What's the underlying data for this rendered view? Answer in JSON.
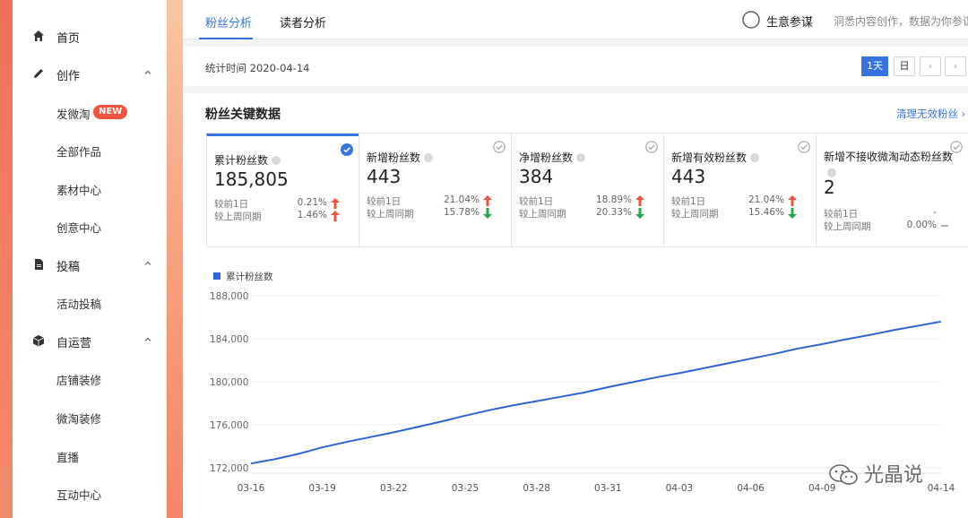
{
  "sidebar": {
    "items": [
      {
        "label": "首页",
        "type": "parent",
        "icon": "home-icon"
      },
      {
        "label": "创作",
        "type": "parent",
        "icon": "pencil-icon",
        "expanded": true
      },
      {
        "label": "发微淘",
        "type": "child",
        "badge": "NEW"
      },
      {
        "label": "全部作品",
        "type": "child"
      },
      {
        "label": "素材中心",
        "type": "child"
      },
      {
        "label": "创意中心",
        "type": "child"
      },
      {
        "label": "投稿",
        "type": "parent",
        "icon": "document-icon",
        "expanded": true
      },
      {
        "label": "活动投稿",
        "type": "child"
      },
      {
        "label": "自运营",
        "type": "parent",
        "icon": "cube-icon",
        "expanded": true
      },
      {
        "label": "店铺装修",
        "type": "child"
      },
      {
        "label": "微淘装修",
        "type": "child"
      },
      {
        "label": "直播",
        "type": "child"
      },
      {
        "label": "互动中心",
        "type": "child"
      }
    ]
  },
  "header": {
    "tabs": [
      {
        "label": "粉丝分析",
        "active": true
      },
      {
        "label": "读者分析",
        "active": false
      }
    ],
    "brand_name": "生意参谋",
    "brand_slogan": "洞悉内容创作，数据为你参谋"
  },
  "datebar": {
    "label": "统计时间 2020-04-14",
    "btn_1d": "1天",
    "btn_day": "日",
    "btn_prev": "‹",
    "btn_next": "›"
  },
  "panel": {
    "title": "粉丝关键数据",
    "clean_link": "清理无效粉丝 ›"
  },
  "cards": [
    {
      "title": "累计粉丝数",
      "value": "185,805",
      "selected": true,
      "cmp1_label": "较前1日",
      "cmp1_val": "0.21%",
      "cmp1_dir": "up",
      "cmp2_label": "较上周同期",
      "cmp2_val": "1.46%",
      "cmp2_dir": "up"
    },
    {
      "title": "新增粉丝数",
      "value": "443",
      "selected": false,
      "cmp1_label": "较前1日",
      "cmp1_val": "21.04%",
      "cmp1_dir": "up",
      "cmp2_label": "较上周同期",
      "cmp2_val": "15.78%",
      "cmp2_dir": "down"
    },
    {
      "title": "净增粉丝数",
      "value": "384",
      "selected": false,
      "cmp1_label": "较前1日",
      "cmp1_val": "18.89%",
      "cmp1_dir": "up",
      "cmp2_label": "较上周同期",
      "cmp2_val": "20.33%",
      "cmp2_dir": "down"
    },
    {
      "title": "新增有效粉丝数",
      "value": "443",
      "selected": false,
      "cmp1_label": "较前1日",
      "cmp1_val": "21.04%",
      "cmp1_dir": "up",
      "cmp2_label": "较上周同期",
      "cmp2_val": "15.46%",
      "cmp2_dir": "down"
    },
    {
      "title": "新增不接收微淘动态粉丝数",
      "value": "2",
      "selected": false,
      "cmp1_label": "较前1日",
      "cmp1_val": "-",
      "cmp1_dir": "none",
      "cmp2_label": "较上周同期",
      "cmp2_val": "0.00%",
      "cmp2_dir": "flat"
    }
  ],
  "colors": {
    "accent": "#3773e0",
    "line": "#2f63d6",
    "up": "#f0533f",
    "down": "#2aa44f"
  },
  "watermark": "光晶说",
  "chart_data": {
    "type": "line",
    "legend": [
      "累计粉丝数"
    ],
    "x": [
      "03-16",
      "03-17",
      "03-18",
      "03-19",
      "03-20",
      "03-21",
      "03-22",
      "03-23",
      "03-24",
      "03-25",
      "03-26",
      "03-27",
      "03-28",
      "03-29",
      "03-30",
      "03-31",
      "04-01",
      "04-02",
      "04-03",
      "04-04",
      "04-05",
      "04-06",
      "04-07",
      "04-08",
      "04-09",
      "04-10",
      "04-11",
      "04-12",
      "04-13",
      "04-14"
    ],
    "x_ticks": [
      "03-16",
      "03-19",
      "03-22",
      "03-25",
      "03-28",
      "03-31",
      "04-03",
      "04-06",
      "04-09",
      "04-14"
    ],
    "series": [
      {
        "name": "累计粉丝数",
        "values": [
          172400,
          172800,
          173300,
          173900,
          174400,
          174850,
          175300,
          175800,
          176300,
          176850,
          177350,
          177800,
          178200,
          178600,
          179000,
          179500,
          179950,
          180400,
          180800,
          181250,
          181700,
          182150,
          182600,
          183100,
          183500,
          183950,
          184350,
          184800,
          185200,
          185600
        ]
      }
    ],
    "y_ticks": [
      "188,000",
      "184,000",
      "180,000",
      "176,000",
      "172,000"
    ],
    "ylim": [
      172000,
      188000
    ],
    "grid": true
  }
}
